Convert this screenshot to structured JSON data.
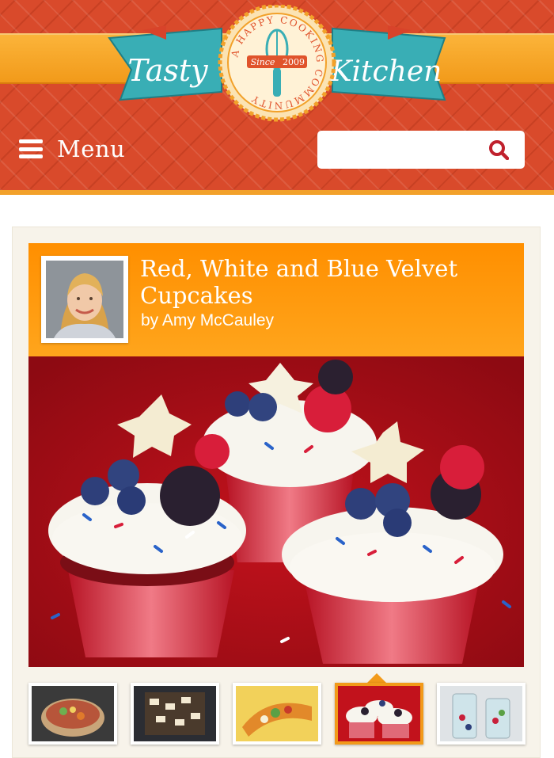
{
  "header": {
    "logo": {
      "left_word": "Tasty",
      "right_word": "Kitchen",
      "tagline": "A HAPPY COOKING COMMUNITY",
      "since": "Since",
      "year": "2009"
    },
    "menu_label": "Menu",
    "search": {
      "value": "",
      "placeholder": ""
    }
  },
  "recipe": {
    "title": "Red, White and Blue Velvet Cupcakes",
    "author": "by Amy McCauley"
  },
  "thumbnails": [
    {
      "name": "salsa-bowl-thumbnail",
      "active": false
    },
    {
      "name": "smores-bars-thumbnail",
      "active": false
    },
    {
      "name": "taco-shells-thumbnail",
      "active": false
    },
    {
      "name": "cupcakes-thumbnail",
      "active": true
    },
    {
      "name": "berry-water-thumbnail",
      "active": false
    }
  ],
  "colors": {
    "header_red": "#d94a2b",
    "header_orange": "#f29a1a",
    "logo_teal": "#39aeb5",
    "title_orange": "#ff8f00",
    "search_icon_red": "#c0212d"
  }
}
